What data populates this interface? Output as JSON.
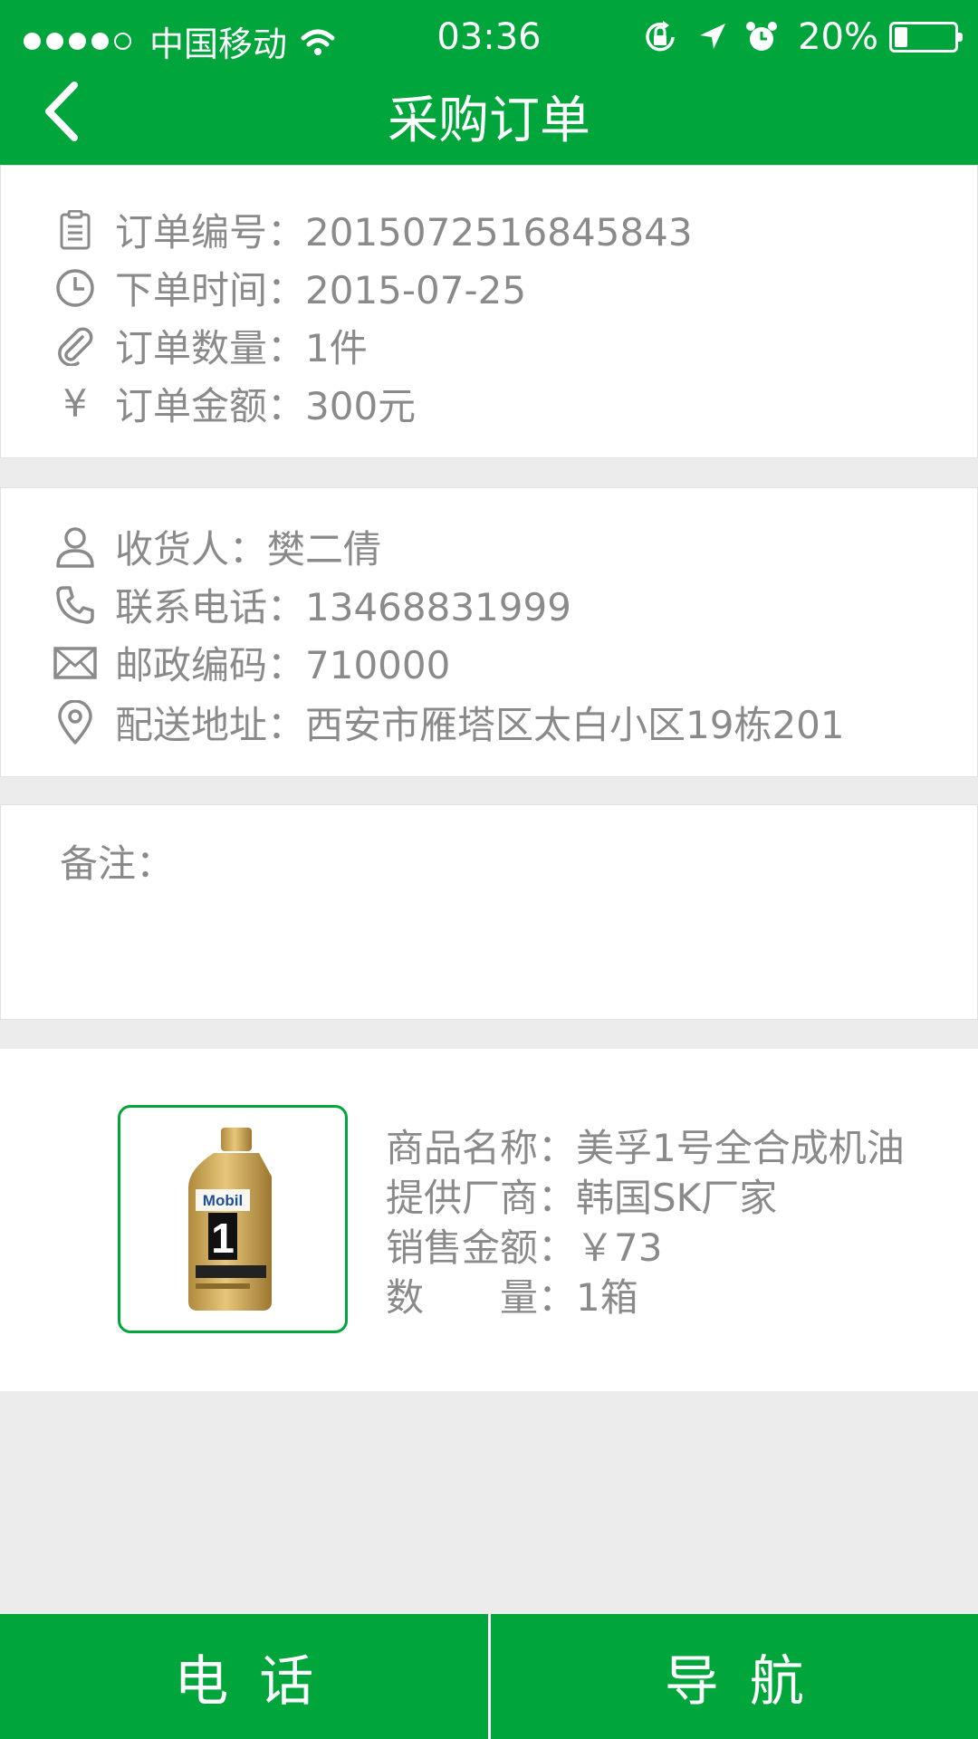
{
  "status_bar": {
    "carrier": "中国移动",
    "time": "03:36",
    "battery": "20%"
  },
  "header": {
    "title": "采购订单"
  },
  "order": {
    "number": "订单编号：2015072516845843",
    "time": "下单时间：2015-07-25",
    "quantity": "订单数量：1件",
    "amount": "订单金额：300元",
    "yen_icon": "¥"
  },
  "receiver": {
    "name": "收货人：樊二倩",
    "phone": "联系电话：13468831999",
    "postcode": "邮政编码：710000",
    "address": "配送地址：西安市雁塔区太白小区19栋201"
  },
  "remark": {
    "label": "备注："
  },
  "product": {
    "name": "商品名称：美孚1号全合成机油",
    "supplier": "提供厂商：韩国SK厂家",
    "price": "销售金额：￥73",
    "quantity": "数　　量：1箱",
    "image_brand": "Mobil",
    "image_number": "1"
  },
  "actions": {
    "call": "电话",
    "navigate": "导航"
  },
  "colors": {
    "primary": "#00a63c",
    "text": "#8a8a8a",
    "background": "#ececec"
  }
}
